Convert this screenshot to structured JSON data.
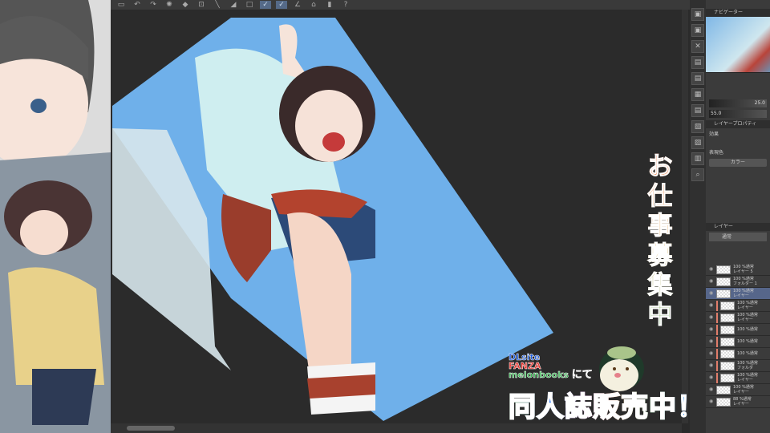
{
  "toolbar": {
    "icons": [
      "save",
      "undo",
      "redo",
      "transform",
      "gear",
      "fill",
      "crop",
      "line",
      "fill-rect",
      "rect",
      "pen-a",
      "pen-b",
      "pen-c",
      "bucket",
      "eraser",
      "help"
    ]
  },
  "navigator": {
    "tab_label": "ナビゲーター",
    "zoom_value": "25.0",
    "angle_value": "55.0"
  },
  "layer_property": {
    "tab_label": "レイヤープロパティ",
    "effect_label": "効果",
    "color_label": "表現色",
    "color_button": "カラー"
  },
  "layers": {
    "tab_label": "レイヤー",
    "blend_mode": "通常",
    "items": [
      {
        "opacity": "100 %通常",
        "name": "レイヤー 5",
        "selected": false,
        "clip": false
      },
      {
        "opacity": "100 %通常",
        "name": "フォルダー 1",
        "selected": false,
        "clip": false
      },
      {
        "opacity": "100 %通常",
        "name": "レイヤー",
        "selected": true,
        "clip": false
      },
      {
        "opacity": "100 %通常",
        "name": "レイヤー",
        "selected": false,
        "clip": true
      },
      {
        "opacity": "100 %通常",
        "name": "レイヤー",
        "selected": false,
        "clip": true
      },
      {
        "opacity": "100 %通常",
        "name": "",
        "selected": false,
        "clip": true
      },
      {
        "opacity": "100 %通常",
        "name": "",
        "selected": false,
        "clip": true
      },
      {
        "opacity": "100 %通常",
        "name": "",
        "selected": false,
        "clip": true
      },
      {
        "opacity": "100 %通常",
        "name": "フォルダ",
        "selected": false,
        "clip": true
      },
      {
        "opacity": "100 %通常",
        "name": "レイヤー",
        "selected": false,
        "clip": true
      },
      {
        "opacity": "100 %通常",
        "name": "レイヤー",
        "selected": false,
        "clip": false
      },
      {
        "opacity": "88 %通常",
        "name": "レイヤー",
        "selected": false,
        "clip": false
      }
    ]
  },
  "overlay": {
    "recruit_text": "お仕事募集中",
    "brand1": "DLsite",
    "brand2": "FANZA",
    "brand3": "melonbooks",
    "ni_te": "にて",
    "sale_text": "同人誌販売中！"
  },
  "colors": {
    "sky": "#6fb0ea",
    "canvas_bg": "#2b2b2b",
    "panel_bg": "#3b3b3b",
    "accent": "#56668a"
  }
}
